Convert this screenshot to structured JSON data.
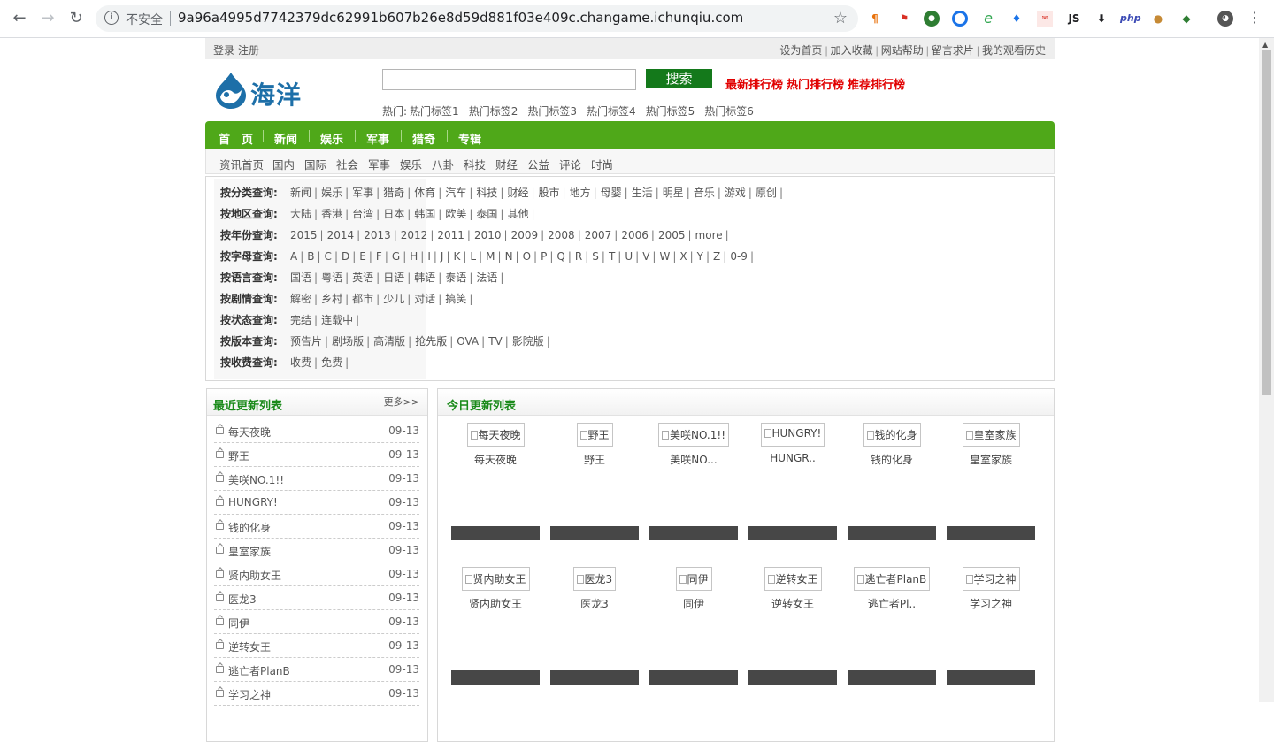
{
  "browser": {
    "security_label": "不安全",
    "url": "9a96a4995d7742379dc62991b607b26e8d59d881f03e409c.changame.ichunqiu.com",
    "extensions": [
      "markdown-icon",
      "pdf-icon",
      "green-globe-icon",
      "circle-icon",
      "e-icon",
      "drop-icon",
      "mail-icon",
      "JS",
      "download-arrow-icon",
      "php",
      "cookie-icon",
      "globe-icon",
      "avatar-icon"
    ],
    "ext_js": "JS",
    "ext_php": "php"
  },
  "topbar": {
    "login": "登录",
    "register": "注册",
    "links": [
      "设为首页",
      "加入收藏",
      "网站帮助",
      "留言求片",
      "我的观看历史"
    ]
  },
  "header": {
    "logo_text": "海洋",
    "search_button": "搜索",
    "search_value": "",
    "rank_links": [
      "最新排行榜",
      "热门排行榜",
      "推荐排行榜"
    ],
    "hot_label": "热门:",
    "hot_tags": [
      "热门标签1",
      "热门标签2",
      "热门标签3",
      "热门标签4",
      "热门标签5",
      "热门标签6"
    ]
  },
  "mainnav": [
    "首　页",
    "新闻",
    "娱乐",
    "军事",
    "猎奇",
    "专辑"
  ],
  "subnav": [
    "资讯首页",
    "国内",
    "国际",
    "社会",
    "军事",
    "娱乐",
    "八卦",
    "科技",
    "财经",
    "公益",
    "评论",
    "时尚"
  ],
  "filters": [
    {
      "label": "按分类查询:",
      "options": [
        "新闻",
        "娱乐",
        "军事",
        "猎奇",
        "体育",
        "汽车",
        "科技",
        "财经",
        "股市",
        "地方",
        "母婴",
        "生活",
        "明星",
        "音乐",
        "游戏",
        "原创"
      ]
    },
    {
      "label": "按地区查询:",
      "options": [
        "大陆",
        "香港",
        "台湾",
        "日本",
        "韩国",
        "欧美",
        "泰国",
        "其他"
      ]
    },
    {
      "label": "按年份查询:",
      "options": [
        "2015",
        "2014",
        "2013",
        "2012",
        "2011",
        "2010",
        "2009",
        "2008",
        "2007",
        "2006",
        "2005",
        "more"
      ]
    },
    {
      "label": "按字母查询:",
      "options": [
        "A",
        "B",
        "C",
        "D",
        "E",
        "F",
        "G",
        "H",
        "I",
        "J",
        "K",
        "L",
        "M",
        "N",
        "O",
        "P",
        "Q",
        "R",
        "S",
        "T",
        "U",
        "V",
        "W",
        "X",
        "Y",
        "Z",
        "0-9"
      ]
    },
    {
      "label": "按语言查询:",
      "options": [
        "国语",
        "粤语",
        "英语",
        "日语",
        "韩语",
        "泰语",
        "法语"
      ]
    },
    {
      "label": "按剧情查询:",
      "options": [
        "解密",
        "乡村",
        "都市",
        "少儿",
        "对话",
        "搞笑"
      ]
    },
    {
      "label": "按状态查询:",
      "options": [
        "完结",
        "连载中"
      ]
    },
    {
      "label": "按版本查询:",
      "options": [
        "预告片",
        "剧场版",
        "高清版",
        "抢先版",
        "OVA",
        "TV",
        "影院版"
      ]
    },
    {
      "label": "按收费查询:",
      "options": [
        "收费",
        "免费"
      ]
    }
  ],
  "recent": {
    "title": "最近更新列表",
    "more": "更多>>",
    "items": [
      {
        "name": "每天夜晚",
        "date": "09-13"
      },
      {
        "name": "野王",
        "date": "09-13"
      },
      {
        "name": "美咲NO.1!!",
        "date": "09-13"
      },
      {
        "name": "HUNGRY!",
        "date": "09-13"
      },
      {
        "name": "钱的化身",
        "date": "09-13"
      },
      {
        "name": "皇室家族",
        "date": "09-13"
      },
      {
        "name": "贤内助女王",
        "date": "09-13"
      },
      {
        "name": "医龙3",
        "date": "09-13"
      },
      {
        "name": "同伊",
        "date": "09-13"
      },
      {
        "name": "逆转女王",
        "date": "09-13"
      },
      {
        "name": "逃亡者PlanB",
        "date": "09-13"
      },
      {
        "name": "学习之神",
        "date": "09-13"
      }
    ]
  },
  "today": {
    "title": "今日更新列表",
    "items": [
      {
        "alt": "每天夜晚",
        "name": "每天夜晚"
      },
      {
        "alt": "野王",
        "name": "野王"
      },
      {
        "alt": "美咲NO.1!!",
        "name": "美咲NO..."
      },
      {
        "alt": "HUNGRY!",
        "name": "HUNGR.."
      },
      {
        "alt": "钱的化身",
        "name": "钱的化身"
      },
      {
        "alt": "皇室家族",
        "name": "皇室家族"
      },
      {
        "alt": "贤内助女王",
        "name": "贤内助女王"
      },
      {
        "alt": "医龙3",
        "name": "医龙3"
      },
      {
        "alt": "同伊",
        "name": "同伊"
      },
      {
        "alt": "逆转女王",
        "name": "逆转女王"
      },
      {
        "alt": "逃亡者PlanB",
        "name": "逃亡者Pl.."
      },
      {
        "alt": "学习之神",
        "name": "学习之神"
      }
    ]
  },
  "colors": {
    "brand_green": "#4fa819",
    "search_green": "#14791b",
    "rank_red": "#e10000",
    "title_green": "#1a8a1a"
  }
}
